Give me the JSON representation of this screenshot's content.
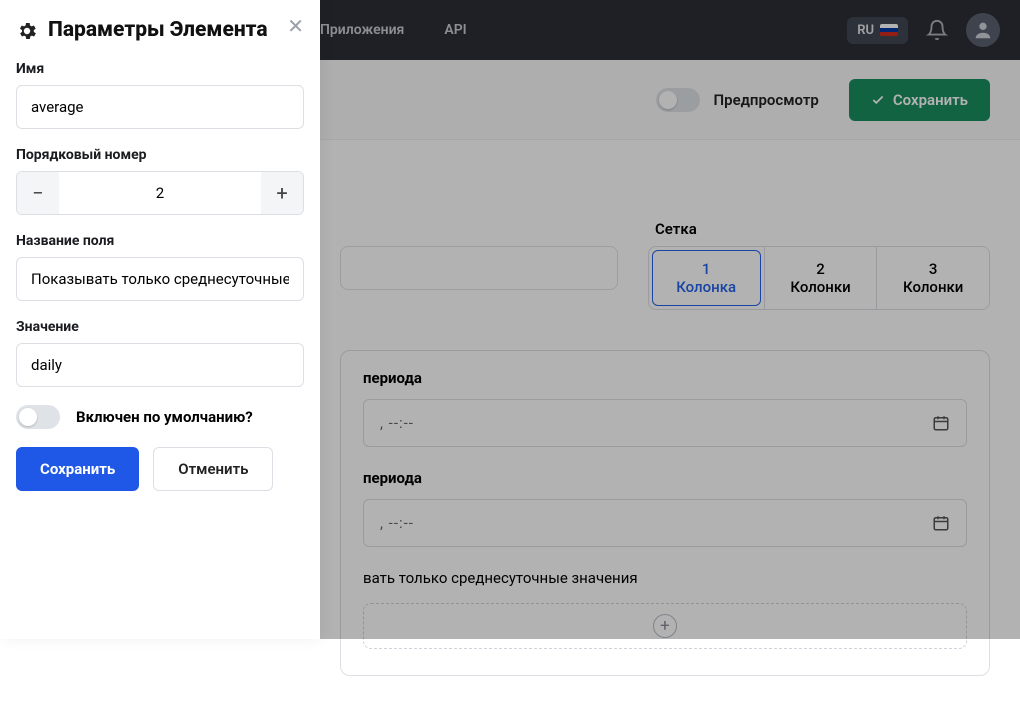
{
  "topbar": {
    "nav": {
      "apps": "Приложения",
      "api": "API"
    },
    "lang": "RU"
  },
  "subbar": {
    "preview_label": "Предпросмотр",
    "save_label": "Сохранить"
  },
  "main": {
    "grid_label": "Сетка",
    "grid_options": {
      "one": "1 Колонка",
      "two": "2 Колонки",
      "three": "3 Колонки"
    },
    "fields": {
      "period_start_label": "периода",
      "period_end_label": "периода",
      "dt_placeholder": ", --:--",
      "daily_avg_label": "вать только среднесуточные значения"
    }
  },
  "drawer": {
    "title": "Параметры Элемента",
    "name_label": "Имя",
    "name_value": "average",
    "order_label": "Порядковый номер",
    "order_value": "2",
    "fieldname_label": "Название поля",
    "fieldname_value": "Показывать только среднесуточные зна",
    "value_label": "Значение",
    "value_value": "daily",
    "default_on_label": "Включен по умолчанию?",
    "save_label": "Сохранить",
    "cancel_label": "Отменить"
  }
}
